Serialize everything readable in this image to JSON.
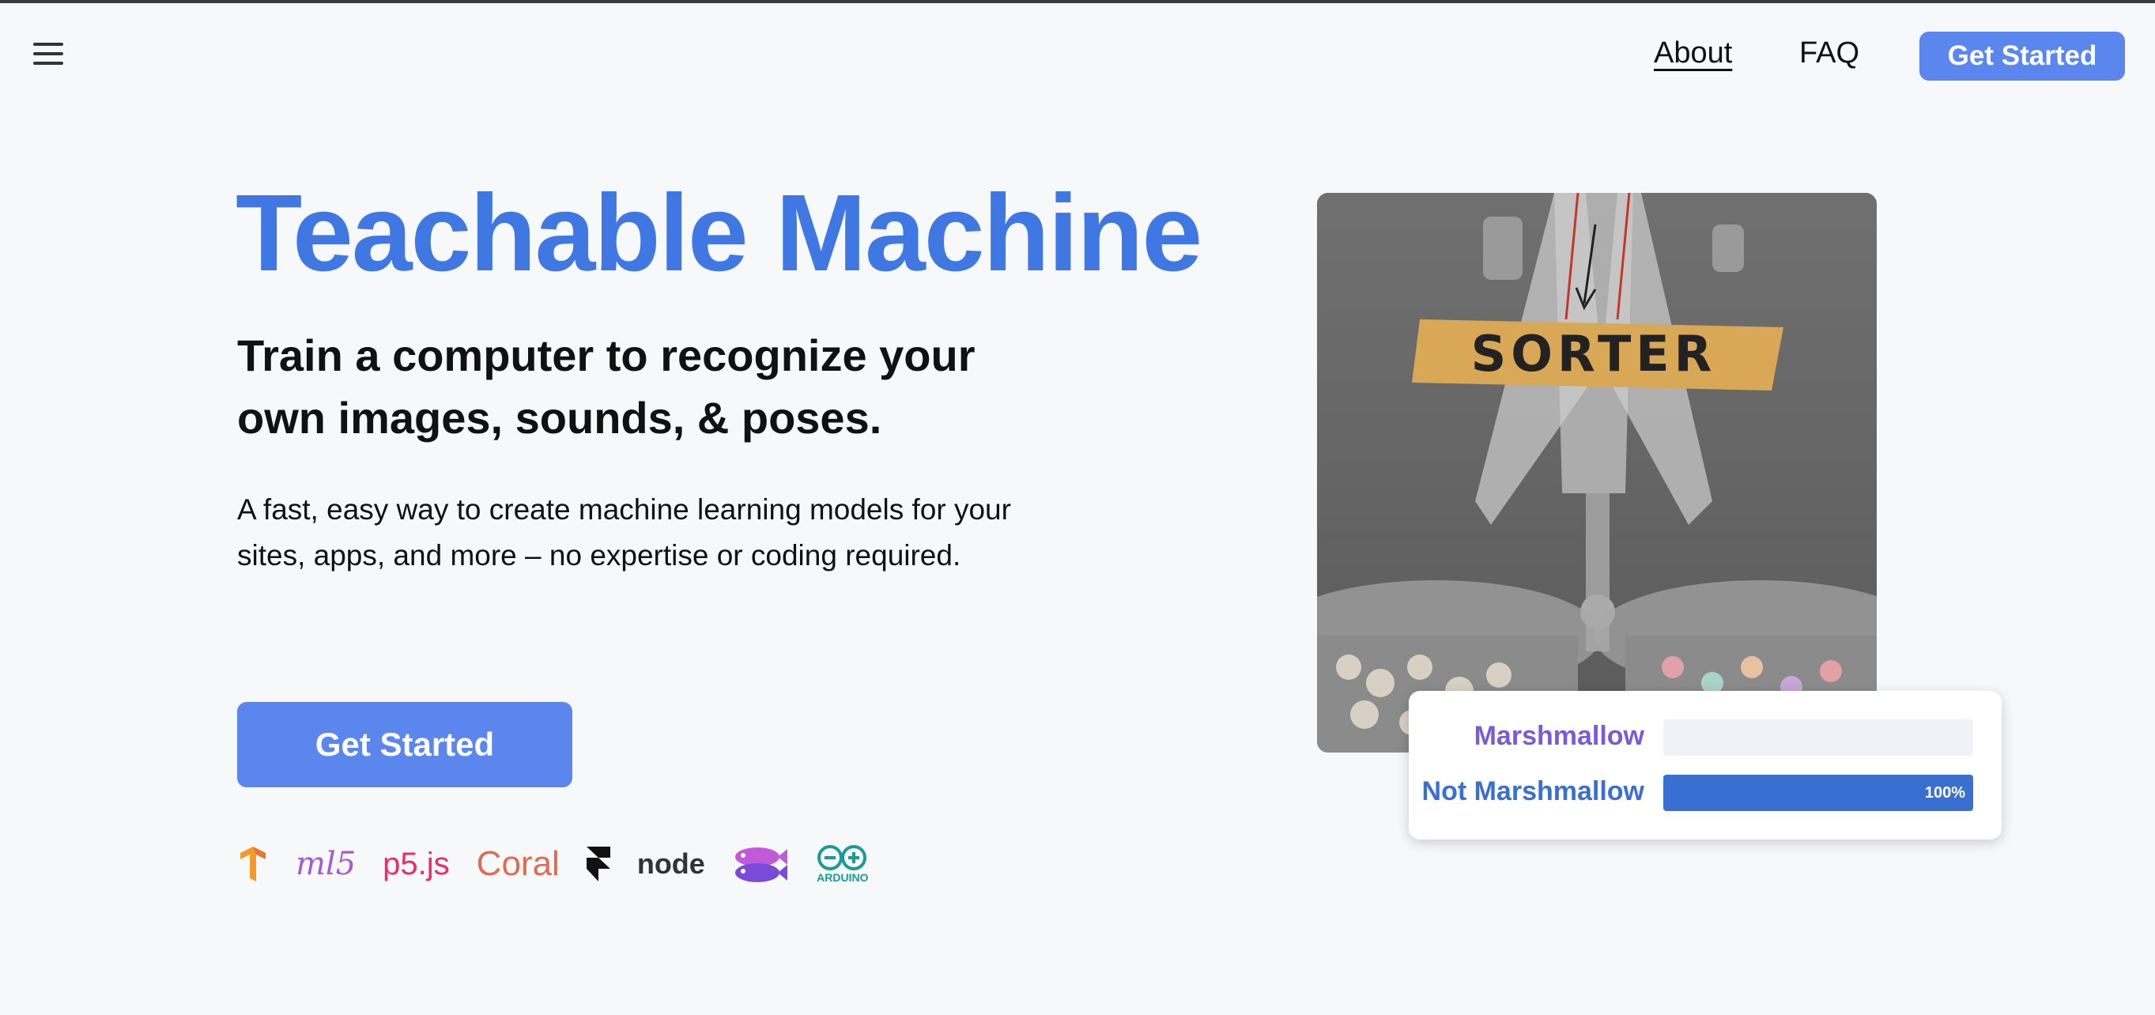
{
  "header": {
    "menu_icon": "hamburger-menu-icon",
    "nav": [
      {
        "label": "About"
      },
      {
        "label": "FAQ"
      }
    ],
    "cta_label": "Get Started"
  },
  "hero": {
    "title": "Teachable Machine",
    "subtitle": "Train a computer to recognize your own images, sounds, & poses.",
    "description": "A fast, easy way to create machine learning models for your sites, apps, and more – no expertise or coding required.",
    "cta_label": "Get Started"
  },
  "logos": [
    {
      "icon": "tensorflow-logo-icon"
    },
    {
      "icon": "ml5-logo-icon",
      "text": "ml5"
    },
    {
      "icon": "p5js-logo-icon",
      "text": "p5.js"
    },
    {
      "icon": "coral-logo-icon",
      "text": "Coral"
    },
    {
      "icon": "framer-logo-icon"
    },
    {
      "icon": "node-logo-icon",
      "text": "node"
    },
    {
      "icon": "glitch-fish-logo-icon"
    },
    {
      "icon": "arduino-logo-icon",
      "text": "ARDUINO"
    }
  ],
  "demo": {
    "image_label": "SORTER",
    "predictions": [
      {
        "label": "Marshmallow",
        "value": 0,
        "color": "#7a5bd6"
      },
      {
        "label": "Not Marshmallow",
        "value": 1.0,
        "percent_text": "100%",
        "color": "#3a6fd2"
      }
    ]
  },
  "colors": {
    "brand_blue": "#3f78e3",
    "button_blue": "#5b86ee",
    "background": "#f7f8fa"
  }
}
